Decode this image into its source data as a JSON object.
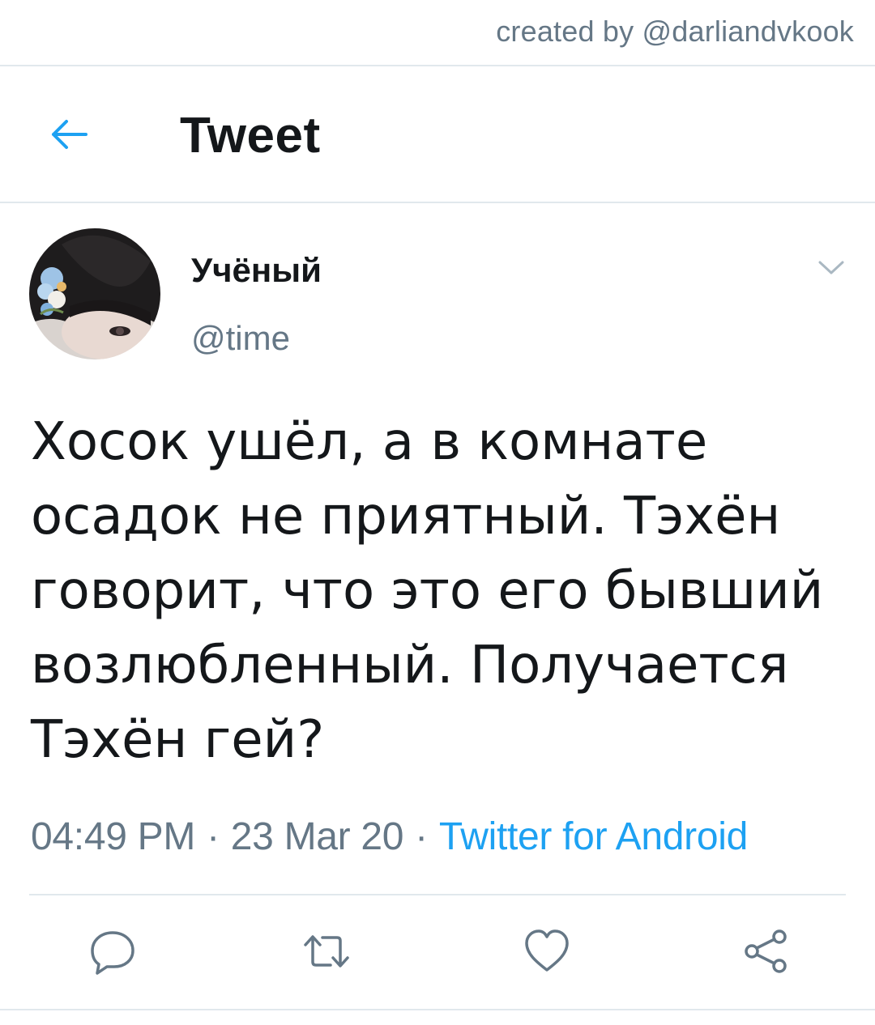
{
  "watermark": {
    "credit": "created by @darliandvkook"
  },
  "header": {
    "back_icon": "back-arrow-icon",
    "title": "Tweet"
  },
  "author": {
    "display_name": "Учёный",
    "handle": "@time",
    "menu_icon": "chevron-down-icon"
  },
  "tweet": {
    "text": "Хосок ушёл, а в комнате осадок не приятный. Тэхён говорит, что это его бывший возлюбленный. Получается Тэхён гей?",
    "time": "04:49 PM",
    "date": "23 Mar 20",
    "separator": "·",
    "source": "Twitter for Android"
  },
  "actions": [
    {
      "name": "reply",
      "icon": "reply-icon"
    },
    {
      "name": "retweet",
      "icon": "retweet-icon"
    },
    {
      "name": "like",
      "icon": "heart-icon"
    },
    {
      "name": "share",
      "icon": "share-icon"
    }
  ],
  "colors": {
    "accent": "#1da1f2",
    "text_primary": "#14171a",
    "text_secondary": "#657786",
    "divider": "#e1e8ed"
  }
}
